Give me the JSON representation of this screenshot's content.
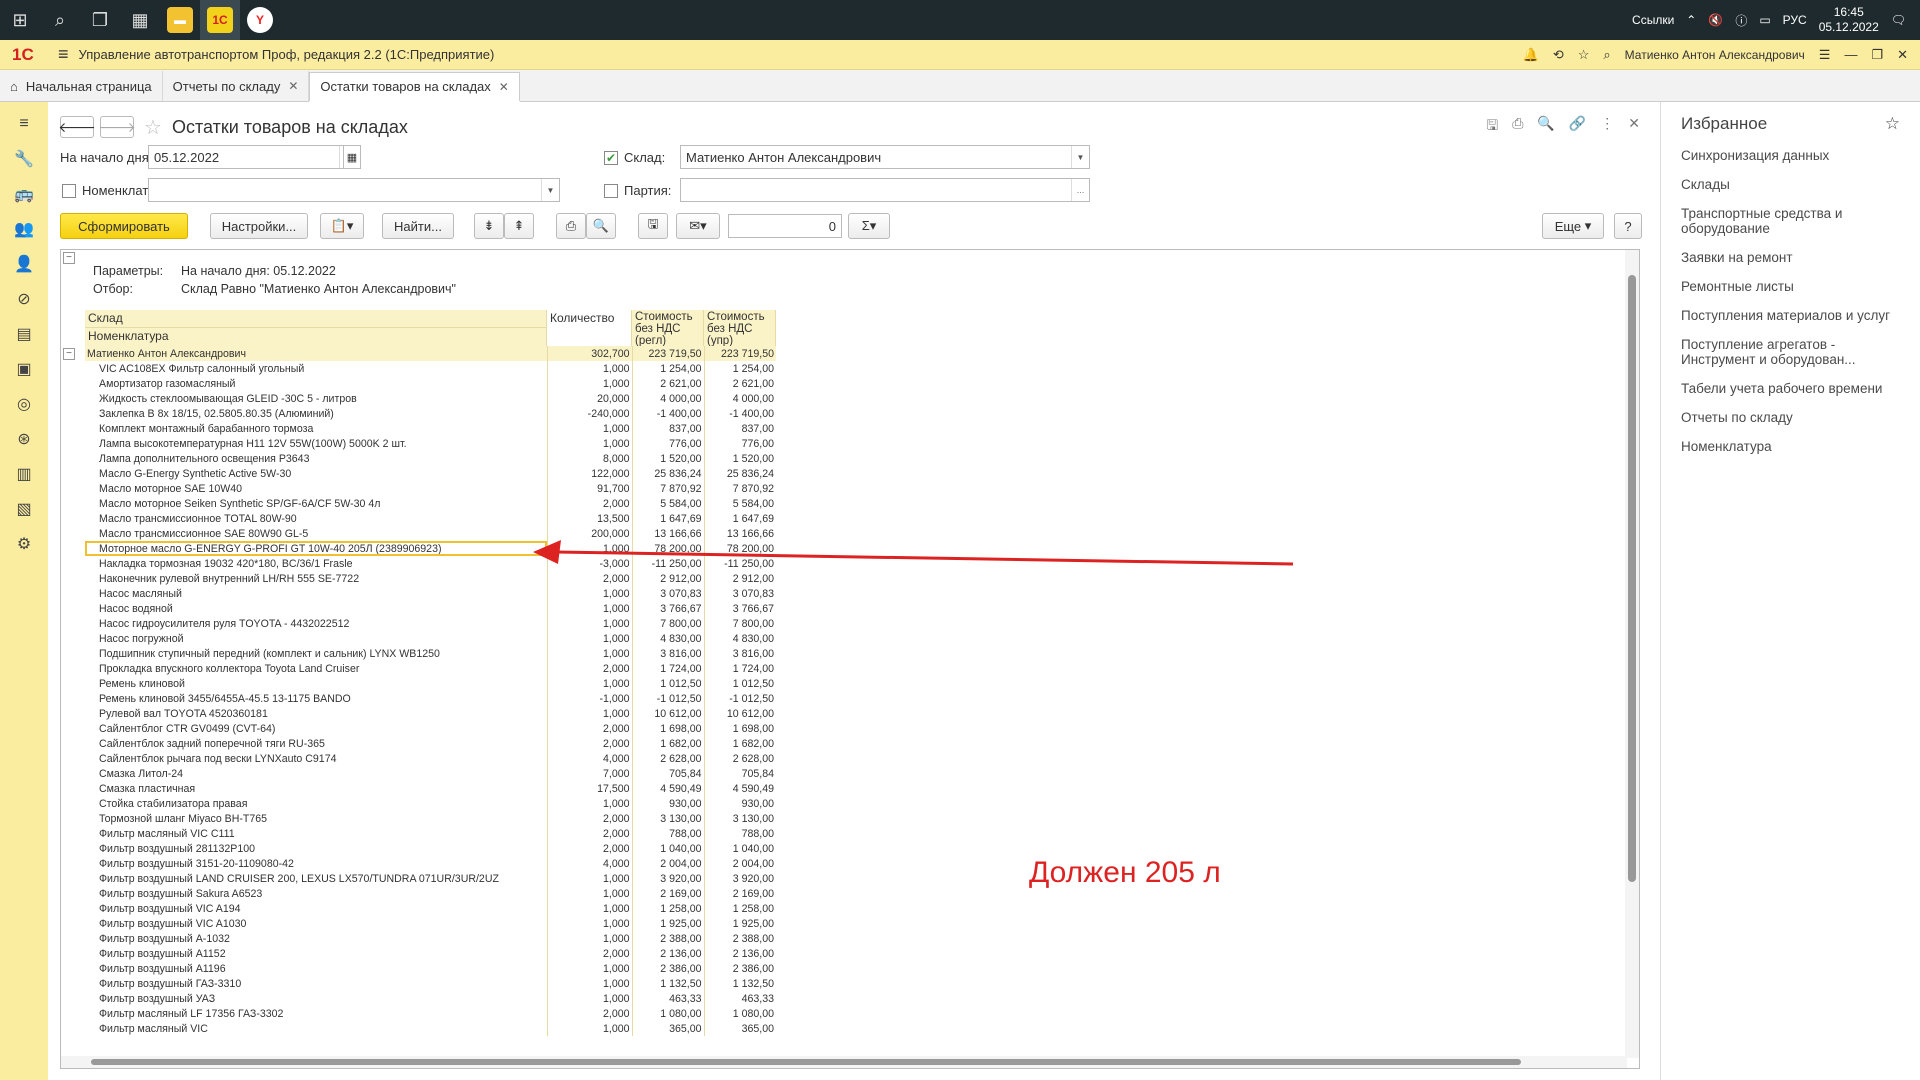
{
  "taskbar": {
    "apps": [
      "windows-start",
      "search",
      "task-view",
      "calendar-app",
      "file-explorer",
      "1c-app",
      "yandex-browser"
    ],
    "tray_links": "Ссылки",
    "lang": "РУС",
    "time": "16:45",
    "date": "05.12.2022"
  },
  "titlebar": {
    "logo": "1С",
    "title": "Управление автотранспортом Проф, редакция 2.2  (1С:Предприятие)",
    "user": "Матиенко Антон Александрович"
  },
  "tabs": [
    {
      "label": "Начальная страница"
    },
    {
      "label": "Отчеты по складу"
    },
    {
      "label": "Остатки товаров на складах"
    }
  ],
  "page": {
    "title": "Остатки товаров на складах",
    "start_date_label": "На начало дня:",
    "start_date_value": "05.12.2022",
    "warehouse_label": "Склад:",
    "warehouse_value": "Матиенко Антон Александрович",
    "nomenclature_label": "Номенклатура:",
    "batch_label": "Партия:",
    "generate_button": "Сформировать",
    "settings_button": "Настройки...",
    "find_button": "Найти...",
    "sum_value": "0",
    "more_button": "Еще",
    "help_button": "?"
  },
  "report": {
    "params_label": "Параметры:",
    "params_value": "На начало дня: 05.12.2022",
    "filter_label": "Отбор:",
    "filter_value": "Склад Равно \"Матиенко Антон Александрович\"",
    "col_warehouse": "Склад",
    "col_nomenclature": "Номенклатура",
    "col_qty": "Количество",
    "col_cost_regl": "Стоимость без НДС (регл)",
    "col_cost_upr": "Стоимость без НДС (упр)",
    "group": {
      "name": "Матиенко Антон Александрович",
      "qty": "302,700",
      "regl": "223 719,50",
      "upr": "223 719,50"
    },
    "rows": [
      [
        "VIC AC108EX Фильтр салонный угольный",
        "1,000",
        "1 254,00",
        "1 254,00"
      ],
      [
        "Амортизатор газомасляный",
        "1,000",
        "2 621,00",
        "2 621,00"
      ],
      [
        "Жидкость стеклоомывающая GLEID -30С 5 - литров",
        "20,000",
        "4 000,00",
        "4 000,00"
      ],
      [
        "Заклепка В 8х 18/15, 02.5805.80.35 (Алюминий)",
        "-240,000",
        "-1 400,00",
        "-1 400,00"
      ],
      [
        "Комплект монтажный барабанного тормоза",
        "1,000",
        "837,00",
        "837,00"
      ],
      [
        "Лампа высокотемпературная H11 12V 55W(100W) 5000K 2 шт.",
        "1,000",
        "776,00",
        "776,00"
      ],
      [
        "Лампа дополнительного освещения P3643",
        "8,000",
        "1 520,00",
        "1 520,00"
      ],
      [
        "Масло G-Energy Synthetic Active 5W-30",
        "122,000",
        "25 836,24",
        "25 836,24"
      ],
      [
        "Масло моторное SAE 10W40",
        "91,700",
        "7 870,92",
        "7 870,92"
      ],
      [
        "Масло моторное Seiken Synthetic SP/GF-6A/CF 5W-30 4л",
        "2,000",
        "5 584,00",
        "5 584,00"
      ],
      [
        "Масло трансмиссионное  TOTAL 80W-90",
        "13,500",
        "1 647,69",
        "1 647,69"
      ],
      [
        "Масло трансмиссионное SAE 80W90 GL-5",
        "200,000",
        "13 166,66",
        "13 166,66"
      ],
      [
        "Моторное масло G-ENERGY G-PROFI GT 10W-40 205Л (2389906923)",
        "1,000",
        "78 200,00",
        "78 200,00"
      ],
      [
        "Накладка тормозная 19032 420*180, BC/36/1 Frasle",
        "-3,000",
        "-11 250,00",
        "-11 250,00"
      ],
      [
        "Наконечник рулевой внутренний LH/RH 555 SE-7722",
        "2,000",
        "2 912,00",
        "2 912,00"
      ],
      [
        "Насос  масляный",
        "1,000",
        "3 070,83",
        "3 070,83"
      ],
      [
        "Насос водяной",
        "1,000",
        "3 766,67",
        "3 766,67"
      ],
      [
        "Насос гидроусилителя руля TOYOTA - 4432022512",
        "1,000",
        "7 800,00",
        "7 800,00"
      ],
      [
        "Насос погружной",
        "1,000",
        "4 830,00",
        "4 830,00"
      ],
      [
        "Подшипник ступичный передний (комплект и сальник) LYNX WB1250",
        "1,000",
        "3 816,00",
        "3 816,00"
      ],
      [
        "Прокладка впускного коллектора Toyota Land Cruiser",
        "2,000",
        "1 724,00",
        "1 724,00"
      ],
      [
        "Ремень клиновой",
        "1,000",
        "1 012,50",
        "1 012,50"
      ],
      [
        "Ремень клиновой 3455/6455А-45.5 13-1175 BANDO",
        "-1,000",
        "-1 012,50",
        "-1 012,50"
      ],
      [
        "Рулевой вал TOYOTA 4520360181",
        "1,000",
        "10 612,00",
        "10 612,00"
      ],
      [
        "Сайлентблог CTR GV0499 (CVT-64)",
        "2,000",
        "1 698,00",
        "1 698,00"
      ],
      [
        "Сайлентблок задний поперечной тяги RU-365",
        "2,000",
        "1 682,00",
        "1 682,00"
      ],
      [
        "Сайлентблок рычага под вески LYNXauto C9174",
        "4,000",
        "2 628,00",
        "2 628,00"
      ],
      [
        "Смазка Литол-24",
        "7,000",
        "705,84",
        "705,84"
      ],
      [
        "Смазка пластичная",
        "17,500",
        "4 590,49",
        "4 590,49"
      ],
      [
        "Стойка стабилизатора правая",
        "1,000",
        "930,00",
        "930,00"
      ],
      [
        "Тормозной шланг Miyaco BH-T765",
        "2,000",
        "3 130,00",
        "3 130,00"
      ],
      [
        "Фильтр  масляный VIC C111",
        "2,000",
        "788,00",
        "788,00"
      ],
      [
        "Фильтр воздушный 281132P100",
        "2,000",
        "1 040,00",
        "1 040,00"
      ],
      [
        "Фильтр воздушный 3151-20-1109080-42",
        "4,000",
        "2 004,00",
        "2 004,00"
      ],
      [
        "Фильтр воздушный LAND CRUISER 200, LEXUS LX570/TUNDRA 071UR/3UR/2UZ",
        "1,000",
        "3 920,00",
        "3 920,00"
      ],
      [
        "Фильтр воздушный Sakura A6523",
        "1,000",
        "2 169,00",
        "2 169,00"
      ],
      [
        "Фильтр воздушный VIC A194",
        "1,000",
        "1 258,00",
        "1 258,00"
      ],
      [
        "Фильтр воздушный VIC A1030",
        "1,000",
        "1 925,00",
        "1 925,00"
      ],
      [
        "Фильтр воздушный А-1032",
        "1,000",
        "2 388,00",
        "2 388,00"
      ],
      [
        "Фильтр воздушный А1152",
        "2,000",
        "2 136,00",
        "2 136,00"
      ],
      [
        "Фильтр воздушный А1196",
        "1,000",
        "2 386,00",
        "2 386,00"
      ],
      [
        "Фильтр воздушный ГАЗ-3310",
        "1,000",
        "1 132,50",
        "1 132,50"
      ],
      [
        "Фильтр воздушный УАЗ",
        "1,000",
        "463,33",
        "463,33"
      ],
      [
        "Фильтр масляный LF 17356 ГАЗ-3302",
        "2,000",
        "1 080,00",
        "1 080,00"
      ],
      [
        "Фильтр масляный VIC",
        "1,000",
        "365,00",
        "365,00"
      ]
    ],
    "annotation": "Должен 205 л"
  },
  "favorites": {
    "title": "Избранное",
    "items": [
      "Синхронизация данных",
      "Склады",
      "Транспортные средства и оборудование",
      "Заявки на ремонт",
      "Ремонтные листы",
      "Поступления материалов и услуг",
      "Поступление агрегатов - Инструмент и оборудован...",
      "Табели учета рабочего времени",
      "Отчеты по складу",
      "Номенклатура"
    ]
  },
  "colors": {
    "accent": "#fbeda0",
    "primary_button": "#f5d10f",
    "annotation": "#d22222"
  }
}
